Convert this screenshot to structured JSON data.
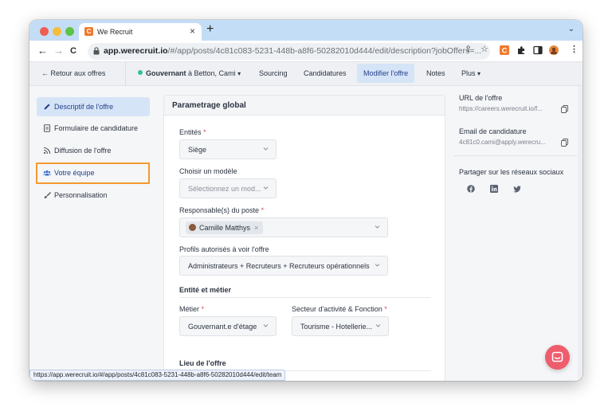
{
  "browser": {
    "tab_title": "We Recruit",
    "tab_close": "×",
    "new_tab": "+",
    "favicon_letter": "C",
    "url_host": "app.werecruit.io",
    "url_rest": "/#/app/posts/4c81c083-5231-448b-a8f6-50282010d444/edit/description?jobOffers=...",
    "back": "←",
    "forward": "→",
    "reload": "C",
    "menu": "⋮",
    "status_url": "https://app.werecruit.io/#/app/posts/4c81c083-5231-448b-a8f6-50282010d444/edit/team"
  },
  "header": {
    "back_label": "← Retour aux offres",
    "job_title": "Gouvernant",
    "job_location": "à Betton, Cami",
    "nav": [
      "Sourcing",
      "Candidatures",
      "Modifier l'offre",
      "Notes",
      "Plus"
    ],
    "active_nav": "Modifier l'offre"
  },
  "sidebar": {
    "items": [
      {
        "label": "Descriptif de l'offre",
        "icon": "pencil-icon",
        "active": true
      },
      {
        "label": "Formulaire de candidature",
        "icon": "form-icon"
      },
      {
        "label": "Diffusion de l'offre",
        "icon": "rss-icon"
      },
      {
        "label": "Votre équipe",
        "icon": "team-icon",
        "highlighted": true
      },
      {
        "label": "Personnalisation",
        "icon": "brush-icon"
      }
    ]
  },
  "panel": {
    "title": "Parametrage global",
    "entites": {
      "label": "Entités",
      "required": "*",
      "value": "Siège"
    },
    "modele": {
      "label": "Choisir un modèle",
      "placeholder": "Sélectionnez un mod..."
    },
    "responsables": {
      "label": "Responsable(s) du poste",
      "required": "*",
      "chip": "Camille Matthys",
      "chip_remove": "×"
    },
    "profils": {
      "label": "Profils autorisés à voir l'offre",
      "value": "Administrateurs + Recruteurs + Recruteurs opérationnels"
    },
    "section_entite": "Entité et métier",
    "metier": {
      "label": "Métier",
      "required": "*",
      "value": "Gouvernant.e d'étage"
    },
    "secteur": {
      "label": "Secteur d'activité & Fonction",
      "required": "*",
      "value": "Tourisme - Hotellerie..."
    },
    "section_lieu": "Lieu de l'offre"
  },
  "right": {
    "url_label": "URL de l'offre",
    "url_value": "https://careers.werecruit.io/f...",
    "email_label": "Email de candidature",
    "email_value": "4c81c0.cami@apply.werecru...",
    "share_label": "Partager sur les réseaux sociaux",
    "social": [
      "facebook-icon",
      "linkedin-icon",
      "twitter-icon"
    ]
  },
  "colors": {
    "accent": "#23408a",
    "active_bg": "#d6e4f7",
    "highlight": "#f29a2e",
    "chat": "#ee5d6c",
    "required": "#e0445a"
  }
}
